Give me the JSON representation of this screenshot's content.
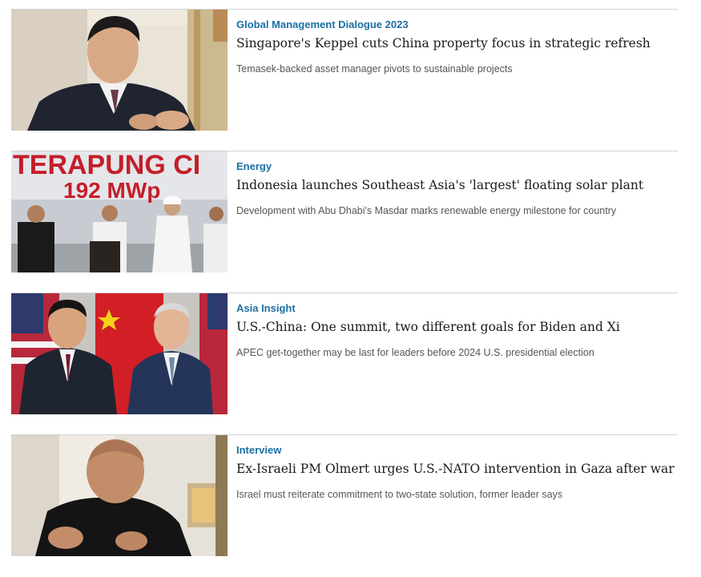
{
  "articles": [
    {
      "category": "Global Management Dialogue 2023",
      "headline": "Singapore's Keppel cuts China property focus in strategic refresh",
      "subhead": "Temasek-backed asset manager pivots to sustainable projects",
      "image_subject": "executive-speaking-photo"
    },
    {
      "category": "Energy",
      "headline": "Indonesia launches Southeast Asia's 'largest' floating solar plant",
      "subhead": "Development with Abu Dhabi's Masdar marks renewable energy milestone for country",
      "image_subject": "solar-plant-launch-photo",
      "image_text": {
        "line1": "TERAPUNG CI",
        "line2": "192 MWp"
      }
    },
    {
      "category": "Asia Insight",
      "headline": "U.S.-China: One summit, two different goals for Biden and Xi",
      "subhead": "APEC get-together may be last for leaders before 2024 U.S. presidential election",
      "image_subject": "leaders-summit-photo"
    },
    {
      "category": "Interview",
      "headline": "Ex-Israeli PM Olmert urges U.S.-NATO intervention in Gaza after war",
      "subhead": "Israel must reiterate commitment to two-state solution, former leader says",
      "image_subject": "interview-portrait-photo"
    }
  ],
  "colors": {
    "category": "#1a6fa3",
    "headline": "#1a1a1a",
    "subhead": "#555555",
    "divider": "#d3d3d3"
  }
}
